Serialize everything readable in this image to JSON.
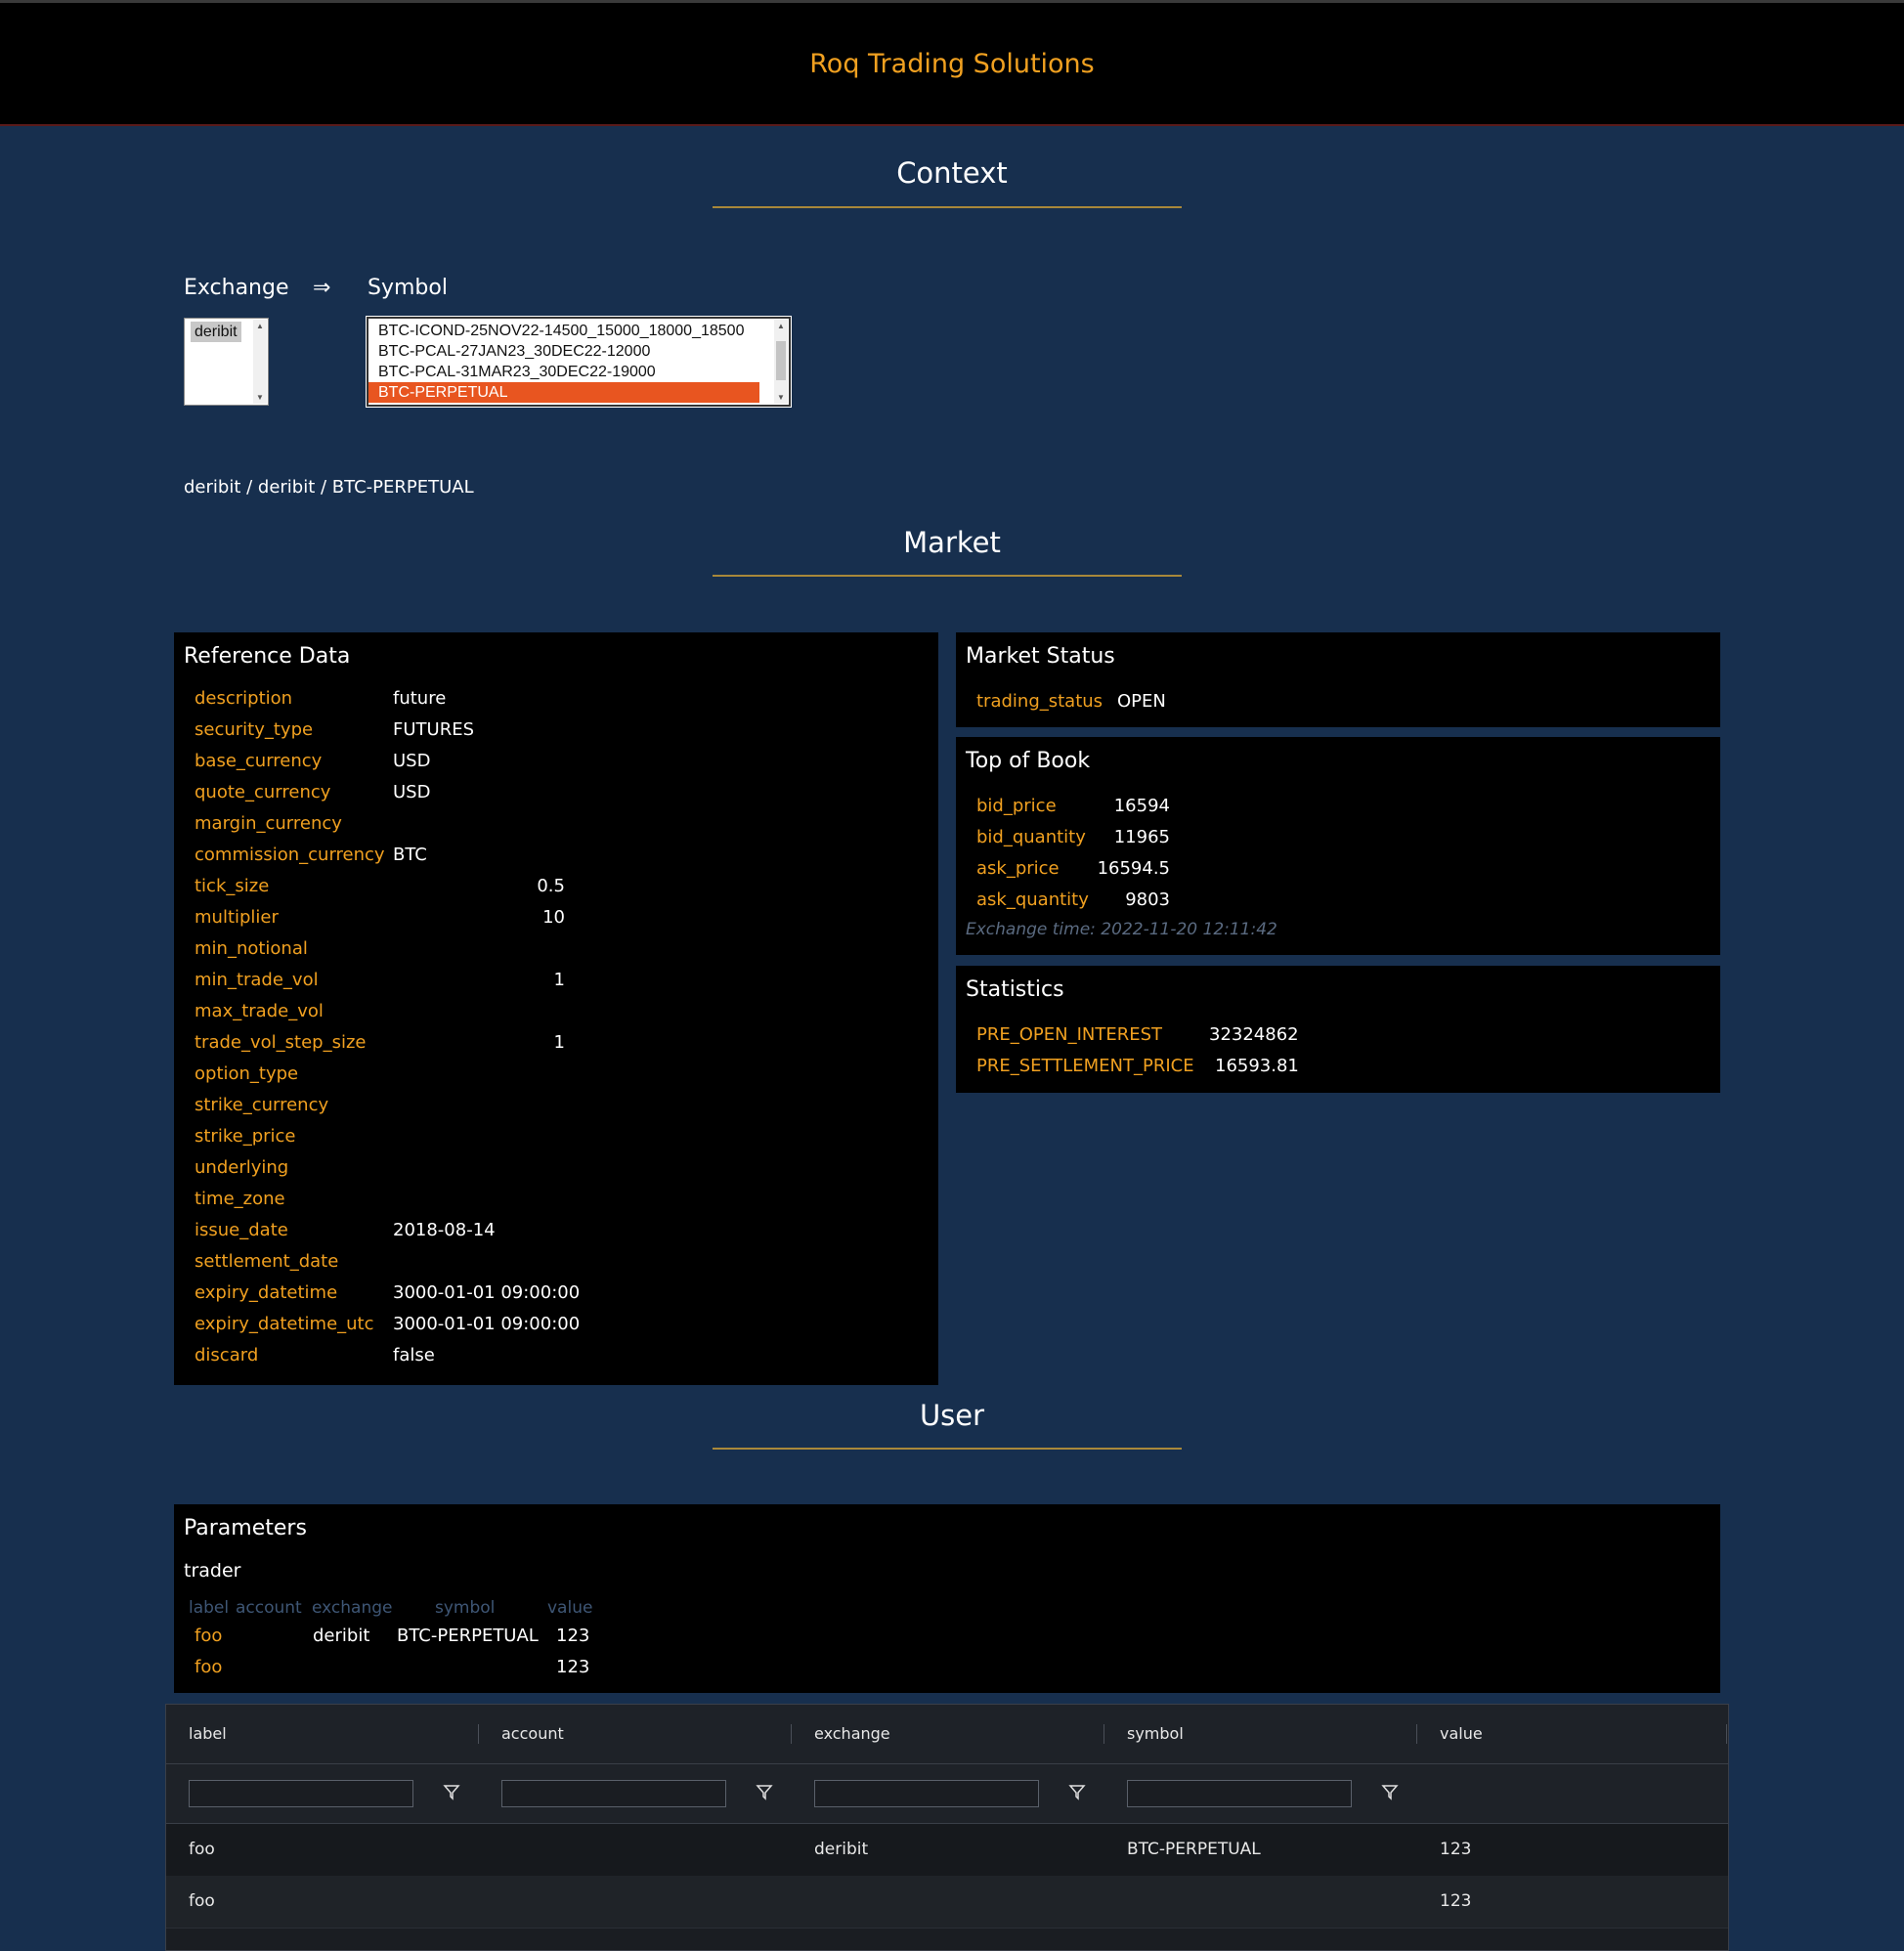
{
  "header": {
    "brand": "Roq Trading Solutions"
  },
  "sections": {
    "context": "Context",
    "market": "Market",
    "user": "User"
  },
  "context": {
    "exchange_label": "Exchange",
    "arrow": "⇒",
    "symbol_label": "Symbol",
    "exchanges": [
      "deribit"
    ],
    "symbols": [
      "BTC-ICOND-25NOV22-14500_15000_18000_18500",
      "BTC-PCAL-27JAN23_30DEC22-12000",
      "BTC-PCAL-31MAR23_30DEC22-19000",
      "BTC-PERPETUAL"
    ],
    "selected_path": "deribit / deribit / BTC-PERPETUAL"
  },
  "reference_data": {
    "title": "Reference Data",
    "rows": [
      {
        "k": "description",
        "v": "future",
        "align": "left"
      },
      {
        "k": "security_type",
        "v": "FUTURES",
        "align": "left"
      },
      {
        "k": "base_currency",
        "v": "USD",
        "align": "left"
      },
      {
        "k": "quote_currency",
        "v": "USD",
        "align": "left"
      },
      {
        "k": "margin_currency",
        "v": "",
        "align": "left"
      },
      {
        "k": "commission_currency",
        "v": "BTC",
        "align": "left"
      },
      {
        "k": "tick_size",
        "v": "0.5",
        "align": "right"
      },
      {
        "k": "multiplier",
        "v": "10",
        "align": "right"
      },
      {
        "k": "min_notional",
        "v": "",
        "align": "right"
      },
      {
        "k": "min_trade_vol",
        "v": "1",
        "align": "right"
      },
      {
        "k": "max_trade_vol",
        "v": "",
        "align": "right"
      },
      {
        "k": "trade_vol_step_size",
        "v": "1",
        "align": "right"
      },
      {
        "k": "option_type",
        "v": "",
        "align": "left"
      },
      {
        "k": "strike_currency",
        "v": "",
        "align": "left"
      },
      {
        "k": "strike_price",
        "v": "",
        "align": "left"
      },
      {
        "k": "underlying",
        "v": "",
        "align": "left"
      },
      {
        "k": "time_zone",
        "v": "",
        "align": "left"
      },
      {
        "k": "issue_date",
        "v": "2018-08-14",
        "align": "left"
      },
      {
        "k": "settlement_date",
        "v": "",
        "align": "left"
      },
      {
        "k": "expiry_datetime",
        "v": "3000-01-01 09:00:00",
        "align": "left"
      },
      {
        "k": "expiry_datetime_utc",
        "v": "3000-01-01 09:00:00",
        "align": "left"
      },
      {
        "k": "discard",
        "v": "false",
        "align": "left"
      }
    ]
  },
  "market_status": {
    "title": "Market Status",
    "rows": [
      {
        "k": "trading_status",
        "v": "OPEN"
      }
    ]
  },
  "top_of_book": {
    "title": "Top of Book",
    "rows": [
      {
        "k": "bid_price",
        "v": "16594"
      },
      {
        "k": "bid_quantity",
        "v": "11965"
      },
      {
        "k": "ask_price",
        "v": "16594.5"
      },
      {
        "k": "ask_quantity",
        "v": "9803"
      }
    ],
    "exchange_time": "Exchange time: 2022-11-20 12:11:42"
  },
  "statistics": {
    "title": "Statistics",
    "rows": [
      {
        "k": "PRE_OPEN_INTEREST",
        "v": "32324862"
      },
      {
        "k": "PRE_SETTLEMENT_PRICE",
        "v": "16593.81"
      }
    ]
  },
  "parameters": {
    "title": "Parameters",
    "user": "trader",
    "headers": [
      "label",
      "account",
      "exchange",
      "symbol",
      "value"
    ],
    "rows": [
      {
        "label": "foo",
        "account": "",
        "exchange": "deribit",
        "symbol": "BTC-PERPETUAL",
        "value": "123"
      },
      {
        "label": "foo",
        "account": "",
        "exchange": "",
        "symbol": "",
        "value": "123"
      }
    ]
  },
  "grid": {
    "columns": [
      "label",
      "account",
      "exchange",
      "symbol",
      "value"
    ],
    "rows": [
      {
        "label": "foo",
        "account": "",
        "exchange": "deribit",
        "symbol": "BTC-PERPETUAL",
        "value": "123"
      },
      {
        "label": "foo",
        "account": "",
        "exchange": "",
        "symbol": "",
        "value": "123"
      }
    ]
  },
  "colors": {
    "accent": "#f0a020",
    "background": "#172f4e",
    "selection": "#e85520"
  }
}
